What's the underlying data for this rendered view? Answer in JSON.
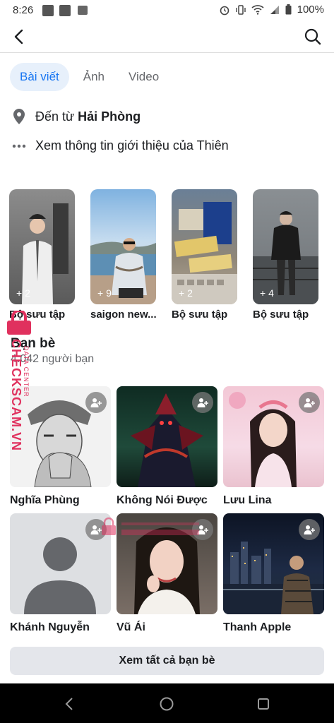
{
  "status": {
    "time": "8:26",
    "battery": "100%"
  },
  "header": {
    "back_icon": "back-arrow-icon",
    "search_icon": "search-icon"
  },
  "tabs": [
    {
      "label": "Bài viết",
      "active": true
    },
    {
      "label": "Ảnh",
      "active": false
    },
    {
      "label": "Video",
      "active": false
    }
  ],
  "about": {
    "hometown_prefix": "Đến từ",
    "hometown": "Hải Phòng",
    "more_info": "Xem thông tin giới thiệu của Thiên"
  },
  "collections": [
    {
      "label": "Bộ sưu tập",
      "count": "+ 2"
    },
    {
      "label": "saigon new...",
      "count": "+ 9"
    },
    {
      "label": "Bộ sưu tập",
      "count": "+ 2"
    },
    {
      "label": "Bộ sưu tập",
      "count": "+ 4"
    }
  ],
  "friends": {
    "title": "Bạn bè",
    "count": "4.042 người bạn",
    "list": [
      {
        "name": "Nghĩa Phùng"
      },
      {
        "name": "Không Nói Được"
      },
      {
        "name": "Lưu Lina"
      },
      {
        "name": "Khánh Nguyễn"
      },
      {
        "name": "Vũ Ái"
      },
      {
        "name": "Thanh Apple"
      }
    ],
    "see_all": "Xem tất cả bạn bè"
  },
  "watermark": {
    "text": "CHECKSCAM.VN",
    "sub": "DATA CENTER"
  },
  "colors": {
    "accent": "#1876f2",
    "tab_active_bg": "#e7f0fb",
    "button_bg": "#e4e6eb",
    "watermark": "#e0315e"
  }
}
